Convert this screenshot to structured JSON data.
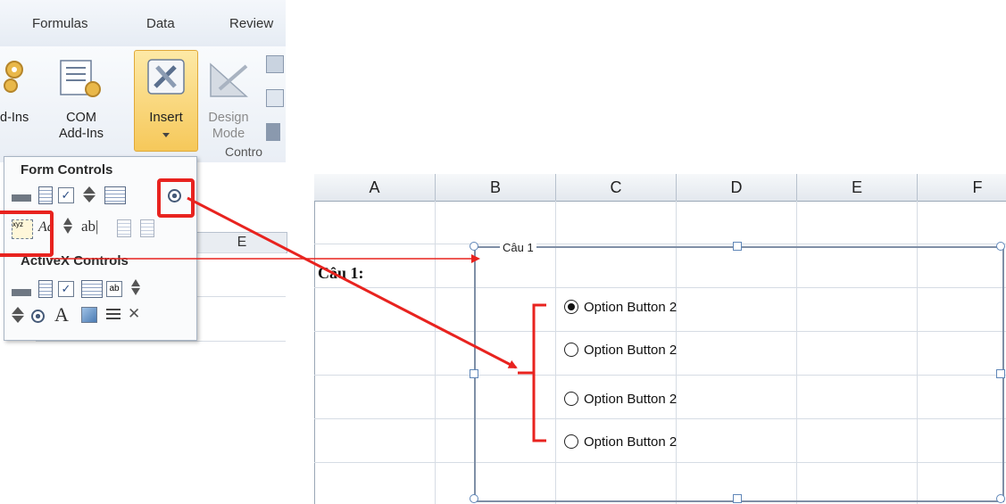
{
  "ribbon": {
    "tabs": [
      "Formulas",
      "Data",
      "Review"
    ],
    "buttons": {
      "addins": "Add-Ins",
      "addins_prefix": "d-Ins",
      "com_addins_line1": "COM",
      "com_addins_line2": "Add-Ins",
      "insert": "Insert",
      "design_mode_line1": "Design",
      "design_mode_line2": "Mode"
    },
    "group_label": "Contro"
  },
  "gallery": {
    "form_controls_title": "Form Controls",
    "activex_controls_title": "ActiveX Controls",
    "text_glyph_abl": "ab|",
    "text_glyph_A": "A"
  },
  "sheet": {
    "columns": [
      "A",
      "B",
      "C",
      "D",
      "E",
      "F"
    ],
    "left_column_header": "E",
    "cell_text": "Câu 1:",
    "group_caption": "Câu 1",
    "options": [
      {
        "label": "Option Button 2",
        "selected": true
      },
      {
        "label": "Option Button 2",
        "selected": false
      },
      {
        "label": "Option Button 2",
        "selected": false
      },
      {
        "label": "Option Button 2",
        "selected": false
      }
    ]
  },
  "colors": {
    "highlight_red": "#e8231f",
    "insert_button": "#f6c85a",
    "header_bg": "#e3e8ee"
  }
}
